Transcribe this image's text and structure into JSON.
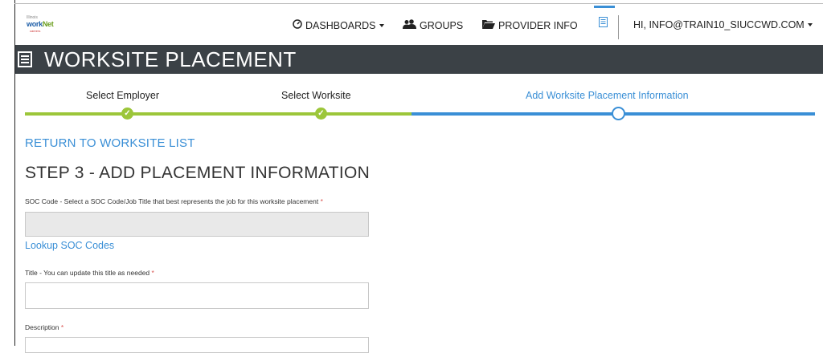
{
  "nav": {
    "logo": {
      "line1": "Illinois",
      "line2a": "work",
      "line2b": "Net",
      "line3": "careers"
    },
    "dashboards": "DASHBOARDS",
    "groups": "GROUPS",
    "provider_info": "PROVIDER INFO",
    "user": "HI, INFO@TRAIN10_SIUCCWD.COM"
  },
  "header": {
    "title": "WORKSITE PLACEMENT"
  },
  "stepper": {
    "steps": [
      {
        "label": "Select Employer",
        "status": "complete"
      },
      {
        "label": "Select Worksite",
        "status": "complete"
      },
      {
        "label": "Add Worksite Placement Information",
        "status": "current"
      }
    ],
    "colors": {
      "complete": "#9cc63a",
      "current": "#3a8fd6"
    }
  },
  "return_link": "RETURN TO WORKSITE LIST",
  "step_title": "STEP 3 - ADD PLACEMENT INFORMATION",
  "form": {
    "soc_label": "SOC Code - Select a SOC Code/Job Title that best represents the job for this worksite placement",
    "soc_value": "",
    "lookup_link": "Lookup SOC Codes",
    "title_label": "Title - You can update this title as needed",
    "title_value": "",
    "description_label": "Description",
    "required_mark": "*"
  }
}
